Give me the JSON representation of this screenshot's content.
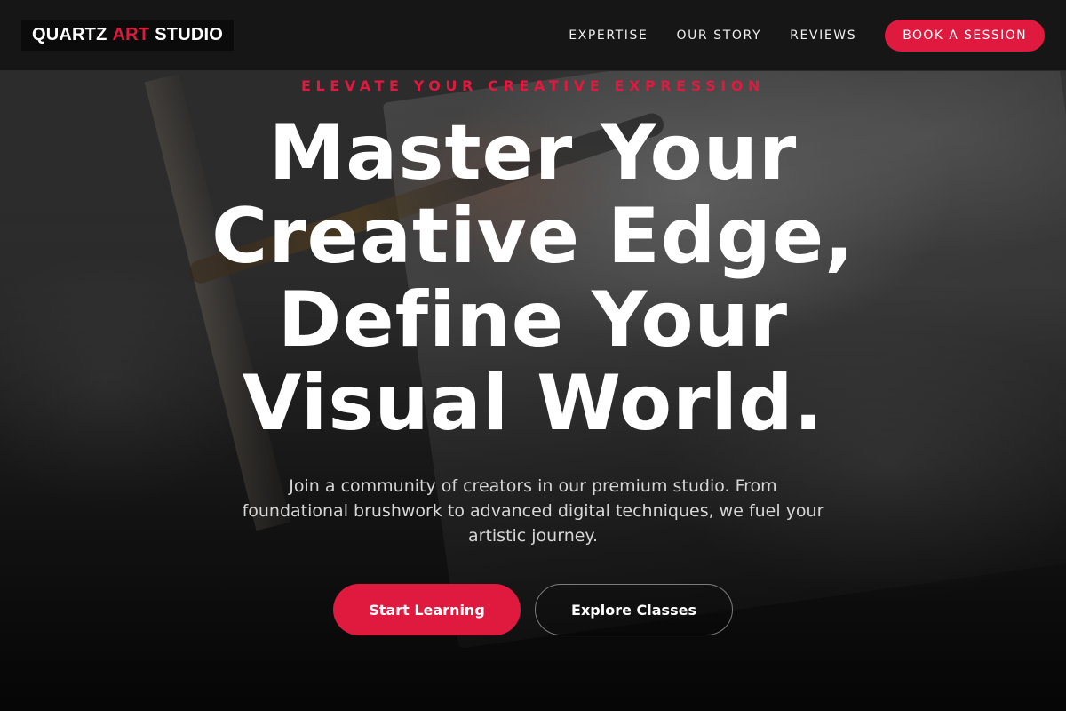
{
  "header": {
    "logo": {
      "part1": "QUARTZ",
      "part2": "ART",
      "part3": "STUDIO"
    },
    "nav": [
      {
        "label": "EXPERTISE"
      },
      {
        "label": "OUR STORY"
      },
      {
        "label": "REVIEWS"
      }
    ],
    "cta_label": "BOOK A SESSION"
  },
  "hero": {
    "eyebrow": "ELEVATE YOUR CREATIVE EXPRESSION",
    "headline_lines": [
      "Master Your",
      "Creative Edge,",
      "Define Your",
      "Visual World."
    ],
    "subtext": "Join a community of creators in our premium studio. From foundational brushwork to advanced digital techniques, we fuel your artistic journey.",
    "primary_button": "Start Learning",
    "secondary_button": "Explore Classes"
  },
  "colors": {
    "accent": "#e0193f",
    "header_bg": "#161616",
    "text": "#ffffff"
  }
}
